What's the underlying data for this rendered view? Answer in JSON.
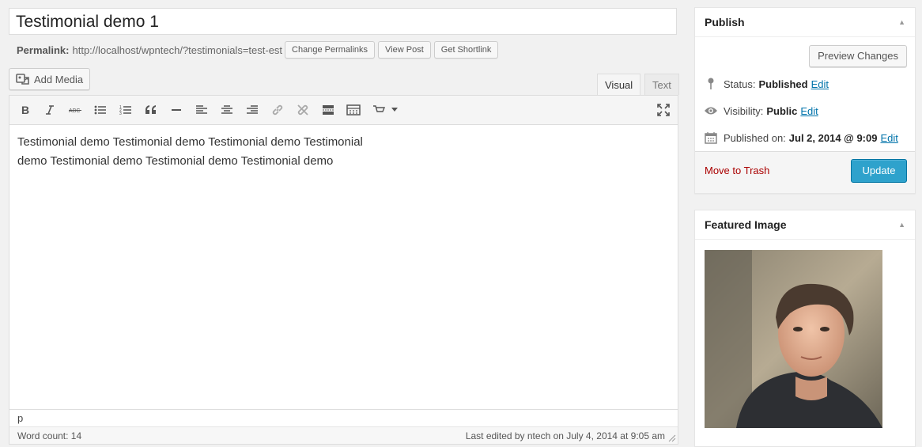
{
  "post": {
    "title": "Testimonial demo 1",
    "permalink_label": "Permalink:",
    "permalink_url": "http://localhost/wpntech/?testimonials=test-est",
    "change_permalinks": "Change Permalinks",
    "view_post": "View Post",
    "get_shortlink": "Get Shortlink"
  },
  "media": {
    "add_media_label": "Add Media"
  },
  "editor": {
    "tabs": {
      "visual": "Visual",
      "text": "Text"
    },
    "toolbar_icons": [
      "bold-icon",
      "italic-icon",
      "strikethrough-icon",
      "bullet-list-icon",
      "numbered-list-icon",
      "blockquote-icon",
      "horizontal-rule-icon",
      "align-left-icon",
      "align-center-icon",
      "align-right-icon",
      "link-icon",
      "unlink-icon",
      "read-more-icon",
      "toolbar-toggle-icon",
      "testimonial-shortcode-icon",
      "dropdown-arrow-icon",
      "fullscreen-icon"
    ],
    "content_line1": "Testimonial demo Testimonial demo Testimonial demo Testimonial",
    "content_line2": "demo Testimonial demo Testimonial demo Testimonial demo",
    "path": "p",
    "word_count": "Word count: 14",
    "last_edited": "Last edited by ntech on July 4, 2014 at 9:05 am"
  },
  "publish": {
    "title": "Publish",
    "preview_changes": "Preview Changes",
    "status_label": "Status:",
    "status_value": "Published",
    "visibility_label": "Visibility:",
    "visibility_value": "Public",
    "published_on_label": "Published on:",
    "published_on_value": "Jul 2, 2014 @ 9:09",
    "edit": "Edit",
    "move_to_trash": "Move to Trash",
    "update": "Update"
  },
  "featured_image": {
    "title": "Featured Image"
  },
  "colors": {
    "primary_button": "#2ea2cc",
    "link": "#0073aa",
    "trash": "#aa0000"
  }
}
